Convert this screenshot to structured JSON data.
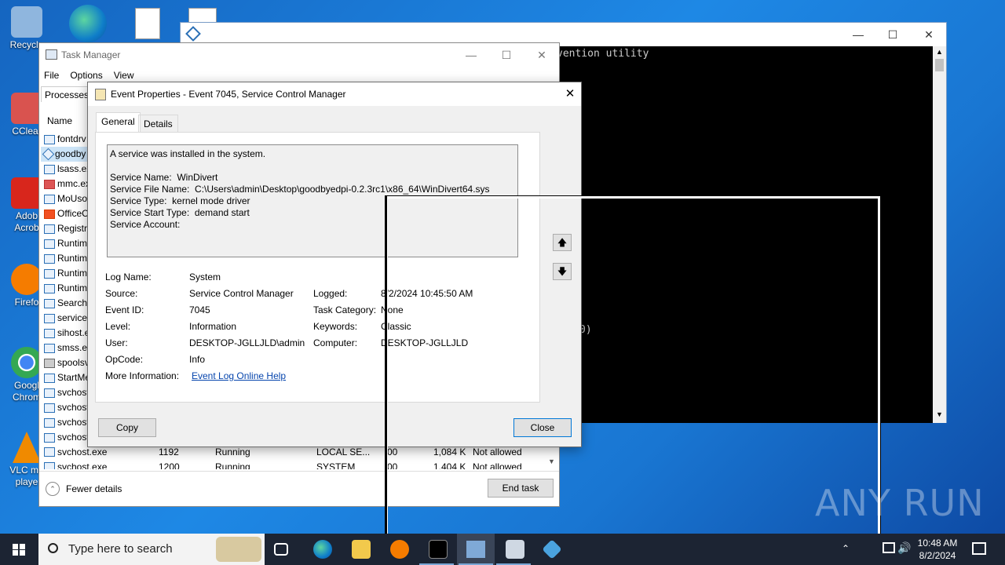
{
  "desktop": {
    "icons": [
      {
        "label": "Recycle",
        "color": "#8fb6de"
      },
      {
        "label": "CClear",
        "color": "#d9534f"
      },
      {
        "label": "Adob Acrob",
        "color": "#d8261c"
      },
      {
        "label": "Firefo",
        "color": "#f57c00"
      },
      {
        "label": "Googl Chrom",
        "color": "#34a853"
      },
      {
        "label": "VLC me playe",
        "color": "#f08a00"
      }
    ]
  },
  "console": {
    "text_line": "vention utility",
    "text_fragment": "0)"
  },
  "taskmgr": {
    "title": "Task Manager",
    "menu": [
      "File",
      "Options",
      "View"
    ],
    "tab_processes": "Processes",
    "col_name": "Name",
    "rows": [
      "fontdrv",
      "goodby",
      "lsass.ex",
      "mmc.ex",
      "MoUso",
      "OfficeC",
      "Registry",
      "Runtim",
      "Runtim",
      "Runtim",
      "Runtim",
      "SearchA",
      "services",
      "sihost.e",
      "smss.ex",
      "spoolsv",
      "StartMe",
      "svchost",
      "svchost",
      "svchost",
      "svchost"
    ],
    "bottom_rows": [
      {
        "name": "svchost.exe",
        "pid": "1192",
        "status": "Running",
        "user": "LOCAL SE...",
        "cpu": "00",
        "mem": "1,084 K",
        "uac": "Not allowed"
      },
      {
        "name": "svchost.exe",
        "pid": "1200",
        "status": "Running",
        "user": "SYSTEM",
        "cpu": "00",
        "mem": "1,404 K",
        "uac": "Not allowed"
      }
    ],
    "fewer_details": "Fewer details",
    "end_task": "End task"
  },
  "dialog": {
    "title": "Event Properties - Event 7045, Service Control Manager",
    "tab_general": "General",
    "tab_details": "Details",
    "description": "A service was installed in the system.\n\nService Name:  WinDivert\nService File Name:  C:\\Users\\admin\\Desktop\\goodbyedpi-0.2.3rc1\\x86_64\\WinDivert64.sys\nService Type:  kernel mode driver\nService Start Type:  demand start\nService Account:",
    "labels": {
      "log_name": "Log Name:",
      "source": "Source:",
      "event_id": "Event ID:",
      "level": "Level:",
      "user": "User:",
      "opcode": "OpCode:",
      "more_info": "More Information:",
      "logged": "Logged:",
      "task_category": "Task Category:",
      "keywords": "Keywords:",
      "computer": "Computer:"
    },
    "values": {
      "log_name": "System",
      "source": "Service Control Manager",
      "event_id": "7045",
      "level": "Information",
      "user": "DESKTOP-JGLLJLD\\admin",
      "opcode": "Info",
      "more_info_link": "Event Log Online Help",
      "logged": "8/2/2024 10:45:50 AM",
      "task_category": "None",
      "keywords": "Classic",
      "computer": "DESKTOP-JGLLJLD"
    },
    "copy_button": "Copy",
    "close_button": "Close"
  },
  "taskbar": {
    "search_placeholder": "Type here to search",
    "time": "10:48 AM",
    "date": "8/2/2024"
  },
  "watermark": "ANY RUN",
  "colors": {
    "accent": "#0078d7",
    "selection": "#cce4f7",
    "link": "#0645ad"
  }
}
